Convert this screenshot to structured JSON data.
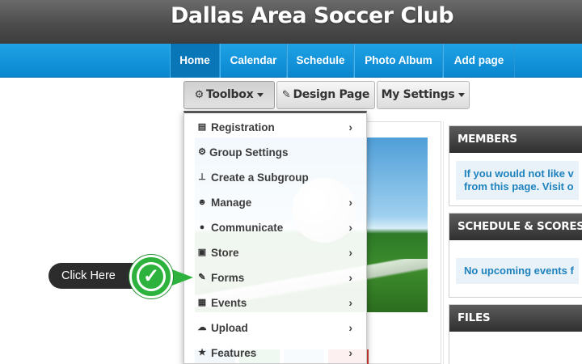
{
  "header": {
    "title": "Dallas Area Soccer Club"
  },
  "nav": {
    "items": [
      {
        "label": "Home",
        "active": true
      },
      {
        "label": "Calendar",
        "active": false
      },
      {
        "label": "Schedule",
        "active": false
      },
      {
        "label": "Photo Album",
        "active": false
      },
      {
        "label": "Add page",
        "active": false
      }
    ]
  },
  "toolbar": {
    "toolbox_label": "Toolbox",
    "design_page_label": "Design Page",
    "my_settings_label": "My Settings"
  },
  "toolbox_menu": {
    "items": [
      {
        "label": "Registration",
        "icon": "list-icon",
        "has_submenu": true
      },
      {
        "label": "Group Settings",
        "icon": "gear-icon",
        "has_submenu": false
      },
      {
        "label": "Create a Subgroup",
        "icon": "sitemap-icon",
        "has_submenu": false
      },
      {
        "label": "Manage",
        "icon": "users-icon",
        "has_submenu": true
      },
      {
        "label": "Communicate",
        "icon": "comments-icon",
        "has_submenu": true
      },
      {
        "label": "Store",
        "icon": "money-icon",
        "has_submenu": true
      },
      {
        "label": "Forms",
        "icon": "edit-icon",
        "has_submenu": true
      },
      {
        "label": "Events",
        "icon": "calendar-icon",
        "has_submenu": true
      },
      {
        "label": "Upload",
        "icon": "cloud-upload-icon",
        "has_submenu": true
      },
      {
        "label": "Features",
        "icon": "star-icon",
        "has_submenu": true
      }
    ]
  },
  "callout": {
    "label": "Click Here",
    "color": "#2db33d"
  },
  "sidebar": {
    "members": {
      "heading": "MEMBERS",
      "text_line1": "If you would not like v",
      "text_line2": "from this page. Visit o"
    },
    "schedule": {
      "heading": "SCHEDULE & SCORES",
      "text": "No upcoming events f"
    },
    "files": {
      "heading": "FILES"
    }
  },
  "colors": {
    "nav_blue": "#0a86cf",
    "header_gray": "#4a4a4a",
    "link_blue": "#1f82bd",
    "accent_green": "#2db33d"
  }
}
